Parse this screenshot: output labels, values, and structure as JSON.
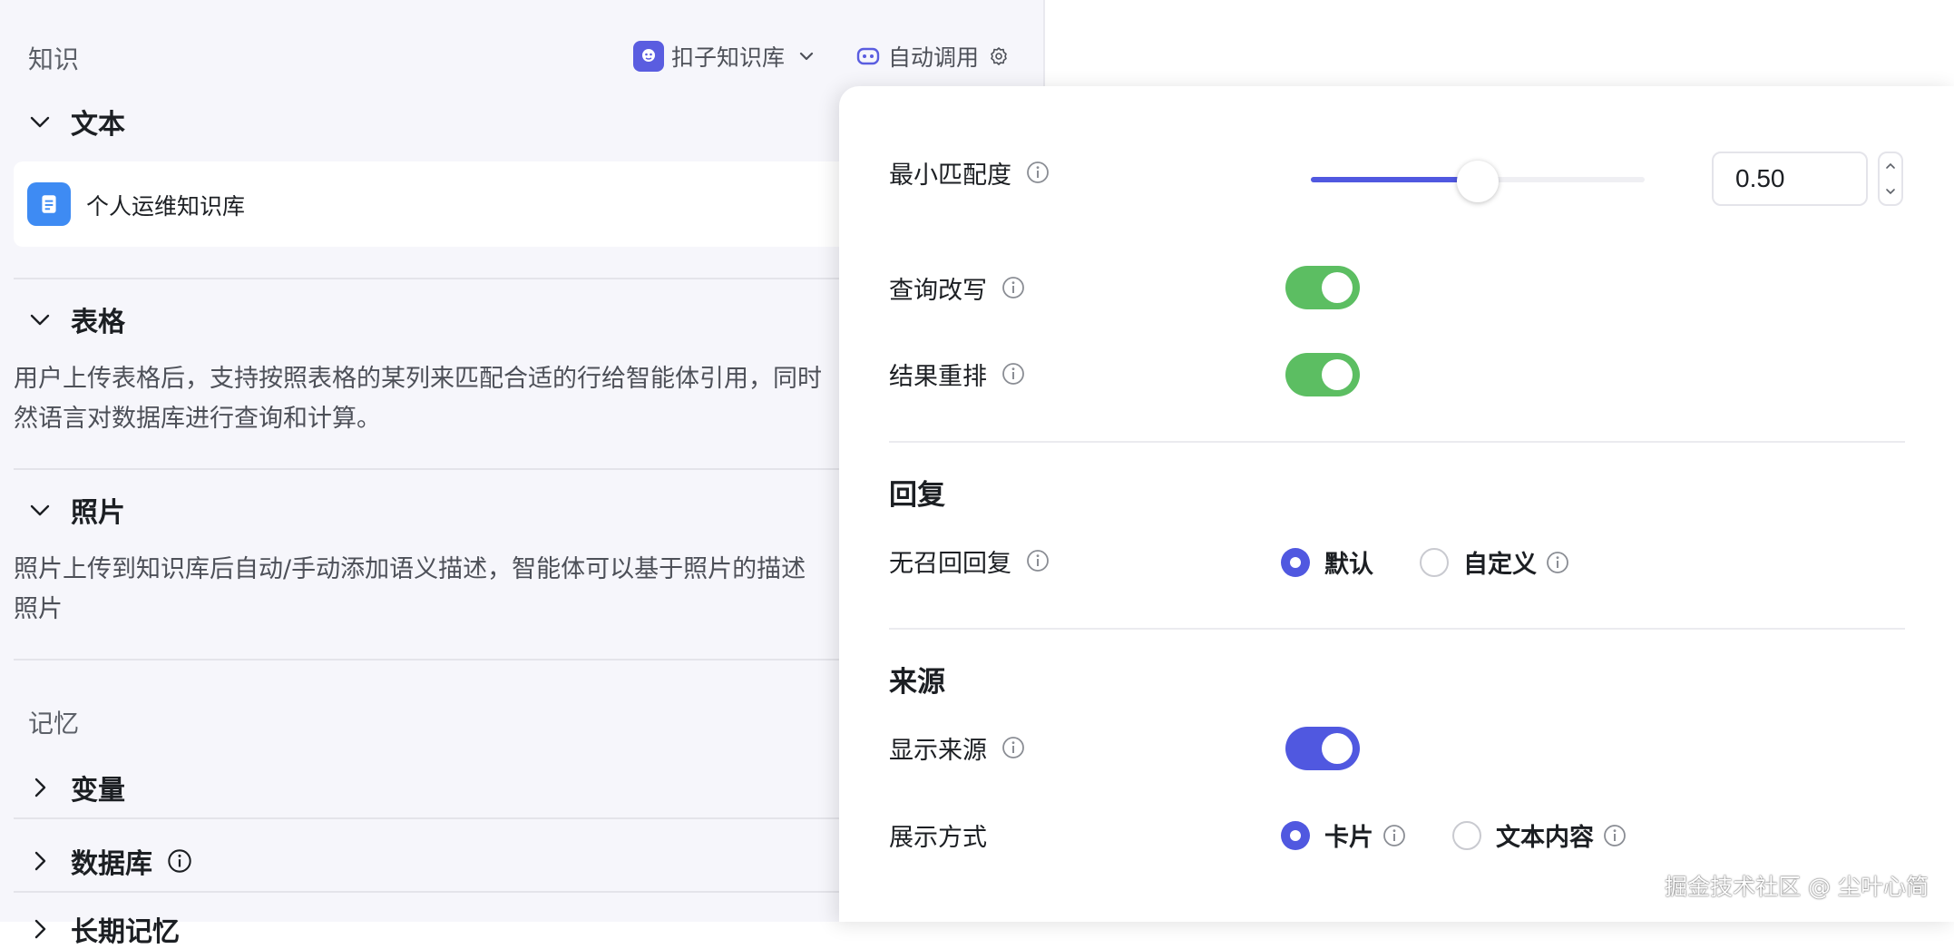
{
  "knowledge": {
    "section_label": "知识",
    "kb_selector_label": "扣子知识库",
    "auto_call_label": "自动调用",
    "text_group": {
      "title": "文本",
      "items": [
        {
          "name": "个人运维知识库"
        }
      ]
    },
    "table_group": {
      "title": "表格",
      "description_line1": "用户上传表格后，支持按照表格的某列来匹配合适的行给智能体引用，同时",
      "description_line2": "然语言对数据库进行查询和计算。"
    },
    "photo_group": {
      "title": "照片",
      "description_line1": "照片上传到知识库后自动/手动添加语义描述，智能体可以基于照片的描述",
      "description_line2": "照片"
    }
  },
  "memory": {
    "section_label": "记忆",
    "variables_label": "变量",
    "database_label": "数据库",
    "long_term_label": "长期记忆"
  },
  "settings_popup": {
    "min_match": {
      "label": "最小匹配度",
      "value": "0.50",
      "fraction": 0.5
    },
    "query_rewrite": {
      "label": "查询改写",
      "enabled": true
    },
    "result_rerank": {
      "label": "结果重排",
      "enabled": true
    },
    "reply": {
      "heading": "回复",
      "no_recall_label": "无召回回复",
      "options": [
        {
          "label": "默认",
          "selected": true
        },
        {
          "label": "自定义",
          "selected": false
        }
      ]
    },
    "source": {
      "heading": "来源",
      "show_source_label": "显示来源",
      "show_source_enabled": true,
      "display_mode_label": "展示方式",
      "options": [
        {
          "label": "卡片",
          "selected": true
        },
        {
          "label": "文本内容",
          "selected": false
        }
      ]
    }
  },
  "watermark": "掘金技术社区 @ 尘叶心简",
  "colors": {
    "accent": "#5058e0",
    "toggle_green": "#5cbe62",
    "panel_bg": "#f6f6fb",
    "kb_icon_blue": "#3e8bf3"
  }
}
